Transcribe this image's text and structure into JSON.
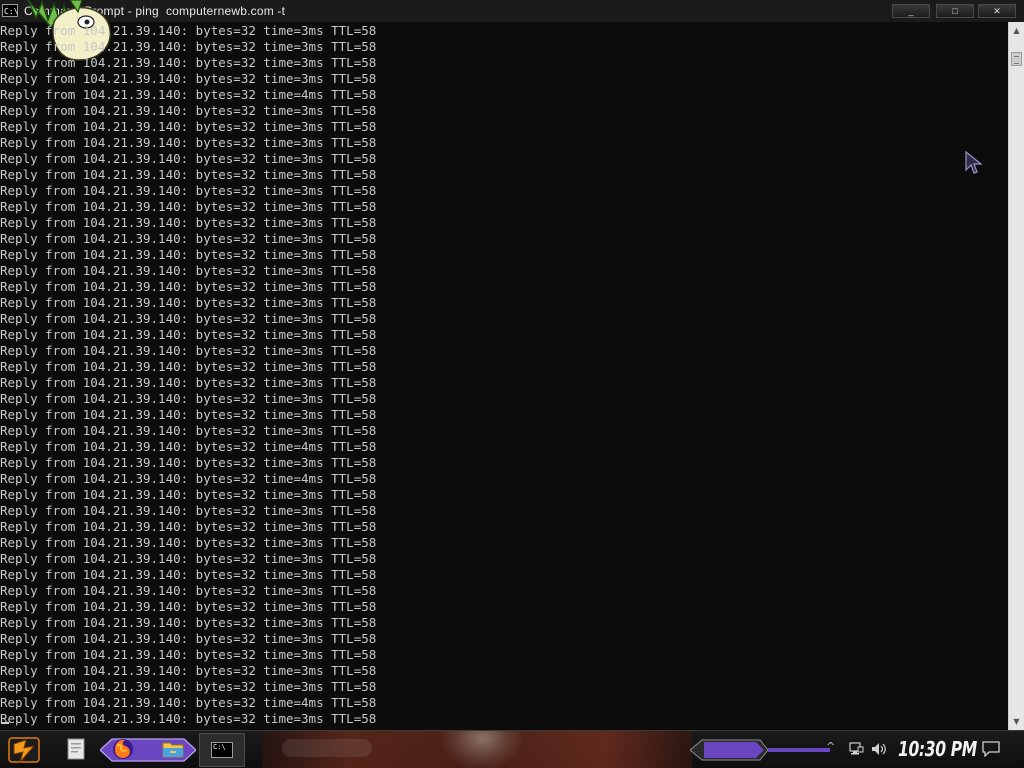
{
  "window": {
    "title": "Command Prompt - ping  computernewb.com -t",
    "app_icon_glyph": "C:\\",
    "buttons": {
      "minimize": "_",
      "maximize": "□",
      "close": "✕"
    }
  },
  "console": {
    "lines": [
      "Reply from 104.21.39.140: bytes=32 time=3ms TTL=58",
      "Reply from 104.21.39.140: bytes=32 time=3ms TTL=58",
      "Reply from 104.21.39.140: bytes=32 time=3ms TTL=58",
      "Reply from 104.21.39.140: bytes=32 time=3ms TTL=58",
      "Reply from 104.21.39.140: bytes=32 time=4ms TTL=58",
      "Reply from 104.21.39.140: bytes=32 time=3ms TTL=58",
      "Reply from 104.21.39.140: bytes=32 time=3ms TTL=58",
      "Reply from 104.21.39.140: bytes=32 time=3ms TTL=58",
      "Reply from 104.21.39.140: bytes=32 time=3ms TTL=58",
      "Reply from 104.21.39.140: bytes=32 time=3ms TTL=58",
      "Reply from 104.21.39.140: bytes=32 time=3ms TTL=58",
      "Reply from 104.21.39.140: bytes=32 time=3ms TTL=58",
      "Reply from 104.21.39.140: bytes=32 time=3ms TTL=58",
      "Reply from 104.21.39.140: bytes=32 time=3ms TTL=58",
      "Reply from 104.21.39.140: bytes=32 time=3ms TTL=58",
      "Reply from 104.21.39.140: bytes=32 time=3ms TTL=58",
      "Reply from 104.21.39.140: bytes=32 time=3ms TTL=58",
      "Reply from 104.21.39.140: bytes=32 time=3ms TTL=58",
      "Reply from 104.21.39.140: bytes=32 time=3ms TTL=58",
      "Reply from 104.21.39.140: bytes=32 time=3ms TTL=58",
      "Reply from 104.21.39.140: bytes=32 time=3ms TTL=58",
      "Reply from 104.21.39.140: bytes=32 time=3ms TTL=58",
      "Reply from 104.21.39.140: bytes=32 time=3ms TTL=58",
      "Reply from 104.21.39.140: bytes=32 time=3ms TTL=58",
      "Reply from 104.21.39.140: bytes=32 time=3ms TTL=58",
      "Reply from 104.21.39.140: bytes=32 time=3ms TTL=58",
      "Reply from 104.21.39.140: bytes=32 time=4ms TTL=58",
      "Reply from 104.21.39.140: bytes=32 time=3ms TTL=58",
      "Reply from 104.21.39.140: bytes=32 time=4ms TTL=58",
      "Reply from 104.21.39.140: bytes=32 time=3ms TTL=58",
      "Reply from 104.21.39.140: bytes=32 time=3ms TTL=58",
      "Reply from 104.21.39.140: bytes=32 time=3ms TTL=58",
      "Reply from 104.21.39.140: bytes=32 time=3ms TTL=58",
      "Reply from 104.21.39.140: bytes=32 time=3ms TTL=58",
      "Reply from 104.21.39.140: bytes=32 time=3ms TTL=58",
      "Reply from 104.21.39.140: bytes=32 time=3ms TTL=58",
      "Reply from 104.21.39.140: bytes=32 time=3ms TTL=58",
      "Reply from 104.21.39.140: bytes=32 time=3ms TTL=58",
      "Reply from 104.21.39.140: bytes=32 time=3ms TTL=58",
      "Reply from 104.21.39.140: bytes=32 time=3ms TTL=58",
      "Reply from 104.21.39.140: bytes=32 time=3ms TTL=58",
      "Reply from 104.21.39.140: bytes=32 time=3ms TTL=58",
      "Reply from 104.21.39.140: bytes=32 time=4ms TTL=58",
      "Reply from 104.21.39.140: bytes=32 time=3ms TTL=58"
    ]
  },
  "scrollbar": {
    "up_arrow": "▲",
    "down_arrow": "▼"
  },
  "taskbar": {
    "clock": "10:30 PM",
    "tray_chevron": "^",
    "cmd_task_glyph": "C:\\",
    "icons": [
      "start-logo-icon",
      "files-icon",
      "firefox-icon",
      "file-explorer-icon",
      "command-prompt-icon",
      "network-icon",
      "volume-icon",
      "notification-icon"
    ]
  },
  "colors": {
    "console_bg": "#0c0c0c",
    "console_text": "#c8c8c8",
    "titlebar_bg": "#1b1b1b",
    "taskbar_accent": "#7a4fd0"
  }
}
